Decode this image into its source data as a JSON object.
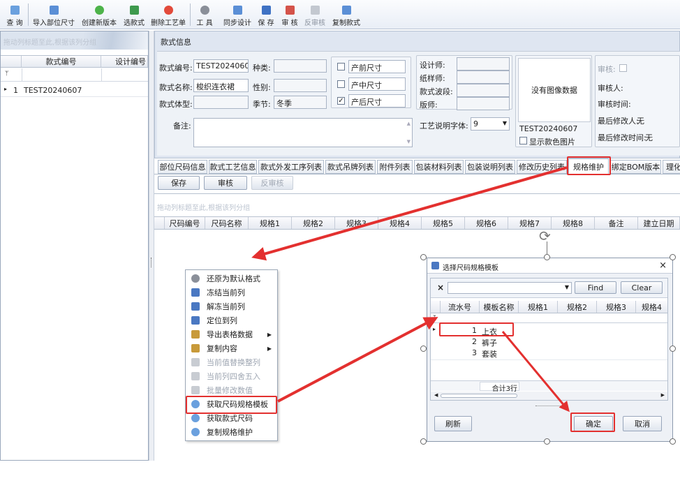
{
  "toolbar": {
    "buttons": [
      {
        "label": "查 询",
        "icon": "search-icon"
      },
      {
        "label": "导入部位尺寸",
        "icon": "import-icon"
      },
      {
        "label": "创建新版本",
        "icon": "add-version-icon"
      },
      {
        "label": "选款式",
        "icon": "select-style-icon"
      },
      {
        "label": "删除工艺单",
        "icon": "delete-icon"
      },
      {
        "label": "工 具",
        "icon": "tools-icon"
      },
      {
        "label": "同步设计",
        "icon": "sync-icon"
      },
      {
        "label": "保 存",
        "icon": "save-icon"
      },
      {
        "label": "审 核",
        "icon": "audit-icon"
      },
      {
        "label": "反审核",
        "icon": "unaudit-icon"
      },
      {
        "label": "复制款式",
        "icon": "copy-style-icon"
      }
    ]
  },
  "left_grid": {
    "group_hint": "拖动列标题至此,根据该列分组",
    "columns": [
      "款式编号",
      "设计编号"
    ],
    "filter_icon": "filter-icon",
    "rows": [
      {
        "index": "1",
        "code": "TEST20240607"
      }
    ]
  },
  "style_info": {
    "title": "款式信息",
    "code_label": "款式编号:",
    "code_value": "TEST20240607",
    "type_label": "种类:",
    "type_value": "",
    "name_label": "款式名称:",
    "name_value": "梭织连衣裙",
    "gender_label": "性别:",
    "gender_value": "",
    "body_label": "款式体型:",
    "body_value": "",
    "season_label": "季节:",
    "season_value": "冬季",
    "note_label": "备注:",
    "pre_size": "产前尺寸",
    "pre_size_checked": false,
    "mid_size": "产中尺寸",
    "mid_size_checked": false,
    "post_size": "产后尺寸",
    "post_size_checked": true,
    "designer_label": "设计师:",
    "patternmaker_label": "纸样师:",
    "wave_label": "款式波段:",
    "plate_label": "版师:",
    "font_label": "工艺说明字体:",
    "font_value": "9",
    "image_placeholder": "没有图像数据",
    "image_code": "TEST20240607",
    "show_color_image": "显示款色图片",
    "audit_label": "审核:",
    "auditor_label": "审核人:",
    "audit_time_label": "审核时间:",
    "last_modifier_label": "最后修改人:",
    "last_modifier_value": "无",
    "last_modified_time_label": "最后修改时间:",
    "last_modified_time_value": "无"
  },
  "tabs": [
    "部位尺码信息",
    "款式工艺信息",
    "款式外发工序列表",
    "款式吊牌列表",
    "附件列表",
    "包装材料列表",
    "包装说明列表",
    "修改历史列表",
    "规格维护",
    "绑定BOM版本",
    "理化"
  ],
  "active_tab": "规格维护",
  "actions": {
    "save": "保存",
    "audit": "审核",
    "unaudit": "反审核"
  },
  "spec_grid": {
    "group_hint": "拖动列标题至此,根据该列分组",
    "columns": [
      "尺码编号",
      "尺码名称",
      "规格1",
      "规格2",
      "规格3",
      "规格4",
      "规格5",
      "规格6",
      "规格7",
      "规格8",
      "备注",
      "建立日期"
    ]
  },
  "context_menu": [
    {
      "label": "还原为默认格式",
      "icon": "gear-icon",
      "disabled": false,
      "submenu": false
    },
    {
      "label": "冻结当前列",
      "icon": "freeze-icon",
      "disabled": false,
      "submenu": false
    },
    {
      "label": "解冻当前列",
      "icon": "unfreeze-icon",
      "disabled": false,
      "submenu": false
    },
    {
      "label": "定位到列",
      "icon": "locate-icon",
      "disabled": false,
      "submenu": false
    },
    {
      "label": "导出表格数据",
      "icon": "export-icon",
      "disabled": false,
      "submenu": true
    },
    {
      "label": "复制内容",
      "icon": "copy-icon",
      "disabled": false,
      "submenu": true
    },
    {
      "label": "当前值替换整列",
      "icon": "replace-icon",
      "disabled": true,
      "submenu": false
    },
    {
      "label": "当前列四舍五入",
      "icon": "round-icon",
      "disabled": true,
      "submenu": false
    },
    {
      "label": "批量修改数值",
      "icon": "batch-edit-icon",
      "disabled": true,
      "submenu": false
    },
    {
      "label": "获取尺码规格模板",
      "icon": "search-icon",
      "disabled": false,
      "submenu": false
    },
    {
      "label": "获取款式尺码",
      "icon": "search-icon",
      "disabled": false,
      "submenu": false
    },
    {
      "label": "复制规格维护",
      "icon": "search-icon",
      "disabled": false,
      "submenu": false
    }
  ],
  "dialog": {
    "title": "选择尺码规格模板",
    "close": "×",
    "clear_x": "×",
    "find": "Find",
    "clear": "Clear",
    "columns": [
      "流水号",
      "模板名称",
      "规格1",
      "规格2",
      "规格3",
      "规格4"
    ],
    "rows": [
      {
        "no": "1",
        "name": "上衣"
      },
      {
        "no": "2",
        "name": "裤子"
      },
      {
        "no": "3",
        "name": "套装"
      }
    ],
    "total": "合计3行",
    "refresh": "刷新",
    "ok": "确定",
    "cancel": "取消"
  },
  "colors": {
    "highlight_red": "#e3302f",
    "panel_blue": "#dfe6f1",
    "border": "#9aa8bc"
  }
}
